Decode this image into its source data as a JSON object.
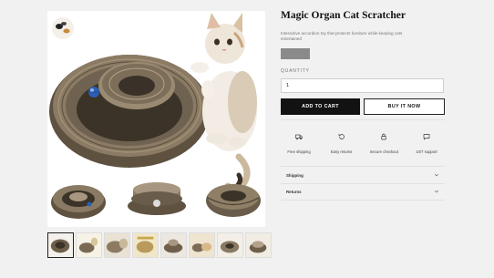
{
  "product": {
    "title": "Magic Organ Cat Scratcher",
    "description": "Interactive accordion toy that protects furniture while keeping cats entertained"
  },
  "quantity": {
    "label": "QUANTITY",
    "value": "1"
  },
  "buttons": {
    "add_to_cart": "ADD TO CART",
    "buy_now": "BUY IT NOW"
  },
  "features": [
    {
      "icon": "truck-icon",
      "label": "Free shipping"
    },
    {
      "icon": "return-icon",
      "label": "Easy returns"
    },
    {
      "icon": "lock-icon",
      "label": "Secure checkout"
    },
    {
      "icon": "chat-icon",
      "label": "24/7 support"
    }
  ],
  "accordions": [
    {
      "label": "Shipping"
    },
    {
      "label": "Returns"
    }
  ],
  "thumbnails": {
    "count": 8,
    "active_index": 0
  },
  "colors": {
    "button_dark": "#121212",
    "cardboard": "#6e5f4b",
    "cardboard_light": "#b3a28a",
    "price_placeholder": "#8a8a8a"
  }
}
